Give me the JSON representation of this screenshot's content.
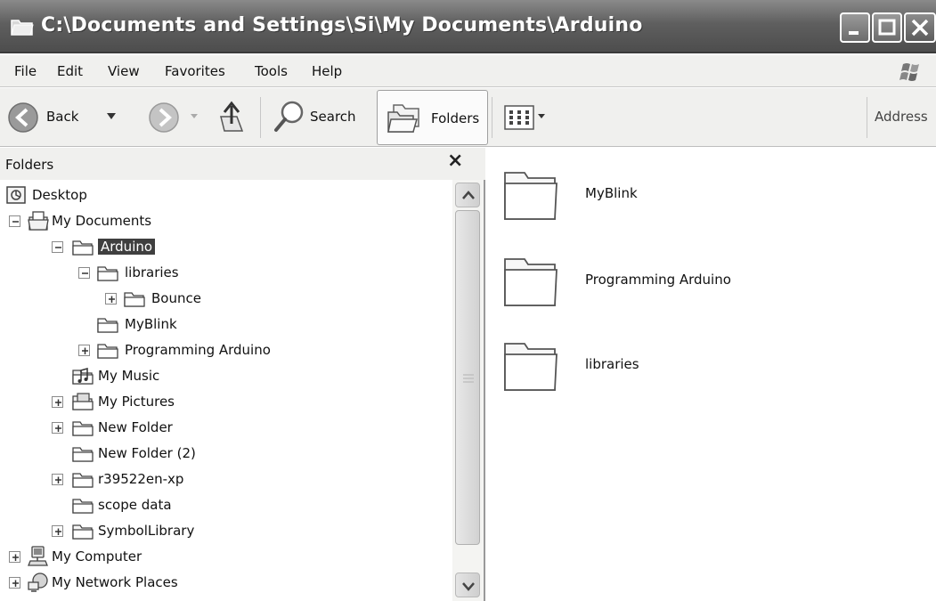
{
  "window": {
    "title": "C:\\Documents and Settings\\Si\\My Documents\\Arduino",
    "title_icon": "folder-window-icon",
    "controls": [
      "minimize-icon",
      "maximize-icon",
      "close-icon"
    ]
  },
  "menubar": {
    "items": [
      {
        "label": "File"
      },
      {
        "label": "Edit"
      },
      {
        "label": "View"
      },
      {
        "label": "Favorites"
      },
      {
        "label": "Tools"
      },
      {
        "label": "Help"
      }
    ],
    "logo_icon": "windows-flag-icon"
  },
  "toolbar": {
    "back_label": "Back",
    "search_label": "Search",
    "folders_label": "Folders",
    "address_label": "Address",
    "icons": [
      "back-arrow-icon",
      "forward-arrow-icon",
      "up-folder-icon",
      "search-magnifier-icon",
      "folders-icon",
      "views-icon"
    ]
  },
  "folders_pane": {
    "title": "Folders",
    "close_glyph": "×",
    "tree": [
      {
        "label": "Desktop",
        "icon": "desktop-icon"
      },
      {
        "label": "My Documents",
        "icon": "my-documents-icon",
        "expander": "minus"
      },
      {
        "label": "Arduino",
        "icon": "folder-icon",
        "expander": "minus",
        "selected": true
      },
      {
        "label": "libraries",
        "icon": "folder-icon",
        "expander": "minus"
      },
      {
        "label": "Bounce",
        "icon": "folder-icon",
        "expander": "plus"
      },
      {
        "label": "MyBlink",
        "icon": "folder-icon"
      },
      {
        "label": "Programming Arduino",
        "icon": "folder-icon",
        "expander": "plus"
      },
      {
        "label": "My Music",
        "icon": "music-folder-icon"
      },
      {
        "label": "My Pictures",
        "icon": "pictures-folder-icon",
        "expander": "plus"
      },
      {
        "label": "New Folder",
        "icon": "folder-icon",
        "expander": "plus"
      },
      {
        "label": "New Folder (2)",
        "icon": "folder-icon"
      },
      {
        "label": "r39522en-xp",
        "icon": "folder-icon",
        "expander": "plus"
      },
      {
        "label": "scope data",
        "icon": "folder-icon"
      },
      {
        "label": "SymbolLibrary",
        "icon": "folder-icon",
        "expander": "plus"
      },
      {
        "label": "My Computer",
        "icon": "my-computer-icon",
        "expander": "plus"
      },
      {
        "label": "My Network Places",
        "icon": "network-places-icon",
        "expander": "plus"
      }
    ]
  },
  "content": {
    "items": [
      {
        "label": "MyBlink",
        "icon": "folder-icon"
      },
      {
        "label": "Programming Arduino",
        "icon": "folder-icon"
      },
      {
        "label": "libraries",
        "icon": "folder-icon"
      }
    ]
  }
}
